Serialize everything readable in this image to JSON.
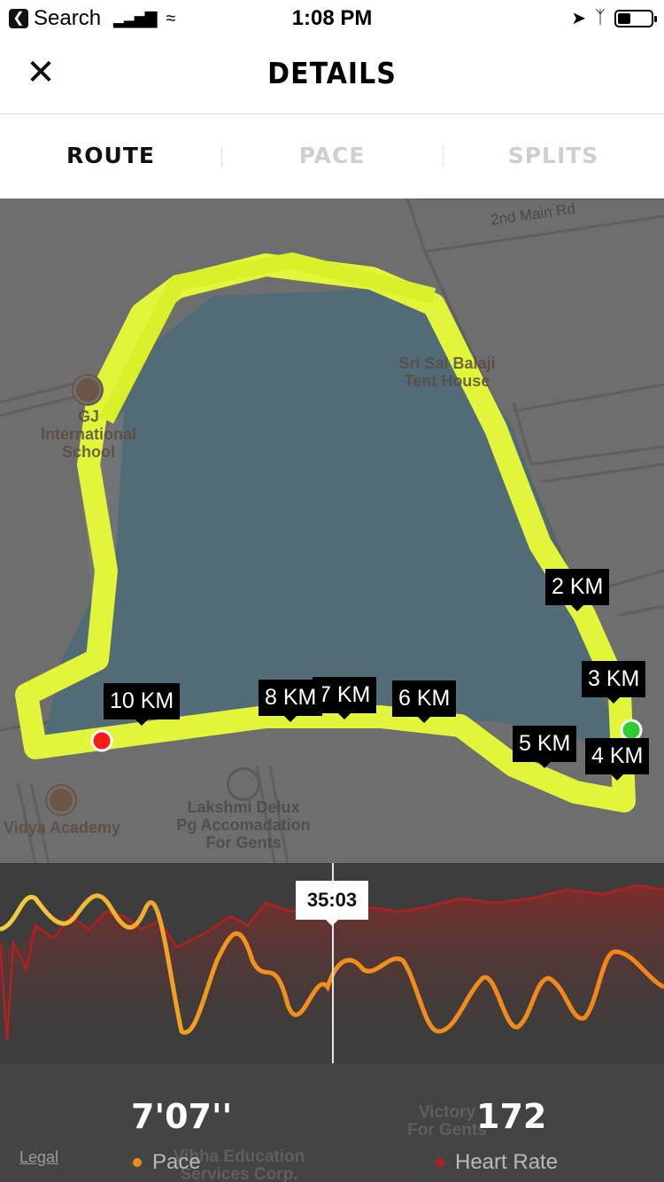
{
  "status_bar": {
    "back_app": "Search",
    "time": "1:08 PM",
    "battery_percent": 40
  },
  "header": {
    "title": "DETAILS",
    "close_icon": "close-icon"
  },
  "tabs": [
    {
      "label": "ROUTE",
      "active": true
    },
    {
      "label": "PACE",
      "active": false
    },
    {
      "label": "SPLITS",
      "active": false
    }
  ],
  "map": {
    "street_label": "2nd Main Rd",
    "places": [
      {
        "name": "Sri Sai Balaji\nTent House"
      },
      {
        "name": "GJ\nInternational\nSchool"
      },
      {
        "name": "Vidya Academy"
      },
      {
        "name": "Lakshmi Delux\nPg Accomadation\nFor Gents"
      }
    ],
    "km_markers": [
      "2 KM",
      "3 KM",
      "4 KM",
      "5 KM",
      "6 KM",
      "7 KM",
      "8 KM",
      "10 KM"
    ],
    "route_color": "#e2f53a",
    "start_color": "#2ecc2e",
    "end_color": "#ff1a1a"
  },
  "chart": {
    "marker_time": "35:03",
    "pace_color": "#f08a1c",
    "heart_color": "#b3201e"
  },
  "stats": {
    "pace_value": "7'07''",
    "pace_label": "Pace",
    "hr_value": "172",
    "hr_label": "Heart Rate"
  },
  "bottom_map_labels": {
    "legal": "Legal",
    "place1": "Vibha Education\nServices Corp.",
    "place2": "Victory\nFor Gents"
  }
}
